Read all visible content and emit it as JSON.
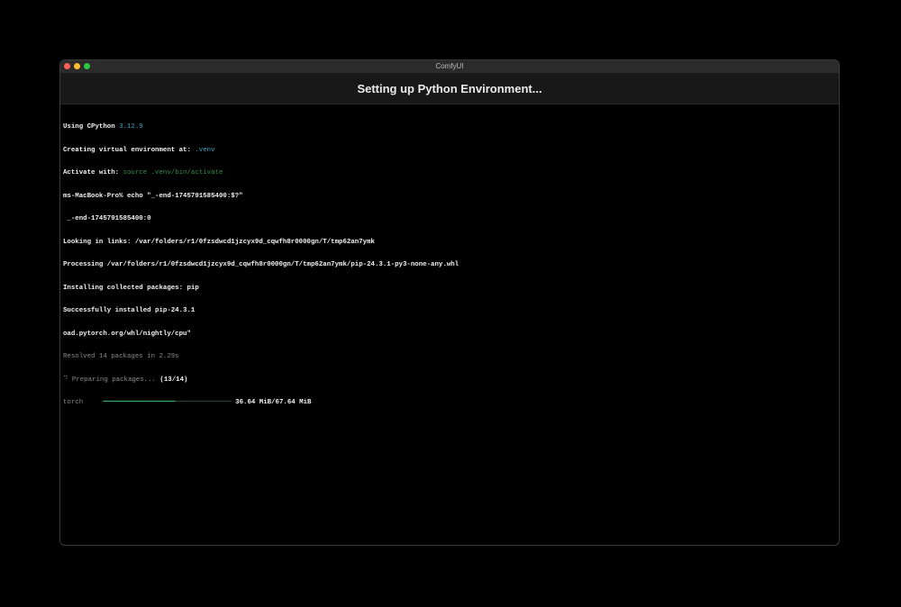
{
  "window": {
    "title": "ComfyUI",
    "traffic_lights": {
      "close_color": "#ff5f57",
      "minimize_color": "#febc2e",
      "maximize_color": "#28c840"
    }
  },
  "header": {
    "title": "Setting up Python Environment..."
  },
  "terminal": {
    "lines": [
      {
        "prefix": "Using CPython ",
        "highlight": "3.12.9"
      },
      {
        "prefix": "Creating virtual environment at: ",
        "highlight": ".venv"
      },
      {
        "prefix": "Activate with: ",
        "highlight": "source .venv/bin/activate"
      },
      {
        "text": "ms-MacBook-Pro% echo \"_-end-1745791585400:$?\""
      },
      {
        "text": " _-end-1745791585400:0"
      },
      {
        "text": "Looking in links: /var/folders/r1/0fzsdwcd1jzcyx9d_cqwfh8r0000gn/T/tmp62an7ymk"
      },
      {
        "text": "Processing /var/folders/r1/0fzsdwcd1jzcyx9d_cqwfh8r0000gn/T/tmp62an7ymk/pip-24.3.1-py3-none-any.whl"
      },
      {
        "text": "Installing collected packages: pip"
      },
      {
        "text": "Successfully installed pip-24.3.1"
      },
      {
        "text": "oad.pytorch.org/whl/nightly/cpu\""
      },
      {
        "text": "Resolved 14 packages in 2.29s"
      },
      {
        "prefix": "⠙ Preparing packages... ",
        "count": "(13/14)"
      },
      {
        "package": "torch     ",
        "bar_done": "━━━━━━━━━━━━━━━━━━",
        "bar_rest": "━━━━━━━━━━━━━━",
        "size": " 36.64 MiB/67.64 MiB"
      }
    ],
    "download_progress": 0.54
  },
  "colors": {
    "background": "#000000",
    "accent_blue": "#3aa3c4",
    "accent_green": "#2f8f43"
  }
}
